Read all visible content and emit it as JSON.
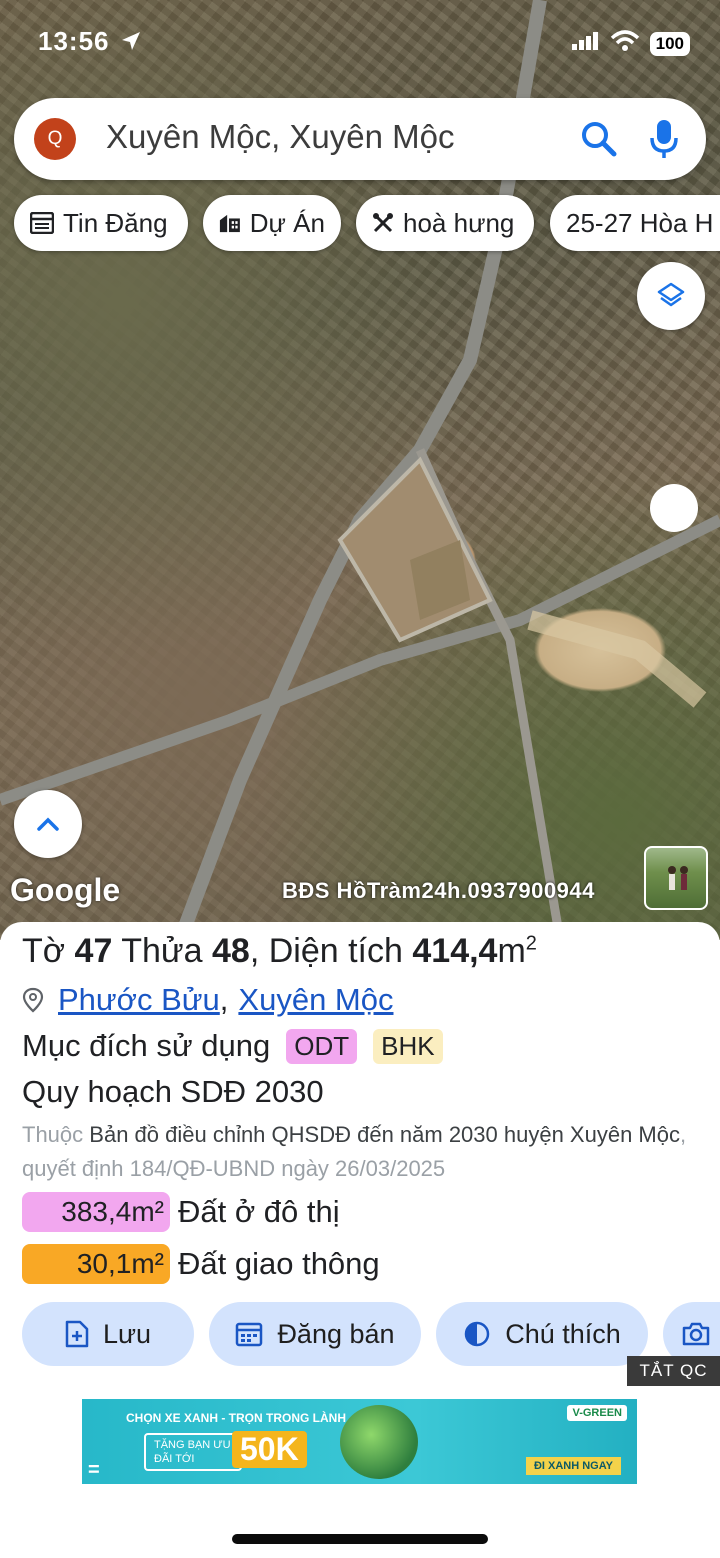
{
  "status": {
    "time": "13:56",
    "battery": "100"
  },
  "search": {
    "logo": "Q",
    "query": "Xuyên Mộc, Xuyên Mộc"
  },
  "chips": [
    {
      "label": "Tin Đăng",
      "icon": "listing-icon"
    },
    {
      "label": "Dự Án",
      "icon": "building-icon"
    },
    {
      "label": "hoà hưng",
      "icon": "crossed-tools-icon"
    },
    {
      "label": "25-27 Hòa H",
      "icon": ""
    }
  ],
  "map": {
    "logo": "Google",
    "watermark": "BĐS HồTràm24h.0937900944"
  },
  "parcel": {
    "to_label": "Tờ",
    "to_value": "47",
    "thua_label": "Thửa",
    "thua_value": "48",
    "area_label": ", Diện tích",
    "area_value": "414,4",
    "area_unit": "m",
    "area_sup": "2",
    "ward": "Phước Bửu",
    "comma": ",",
    "district": "Xuyên Mộc",
    "purpose_label": "Mục đích sử dụng",
    "badges": [
      "ODT",
      "BHK"
    ],
    "plan_title": "Quy hoạch SDĐ 2030",
    "desc_prefix": "Thuộc",
    "desc_main": "Bản đồ điều chỉnh QHSDĐ đến năm 2030 huyện Xuyên Mộc",
    "desc_suffix": ", quyết định 184/QĐ-UBND ngày 26/03/2025",
    "areas": [
      {
        "value": "383,4m²",
        "label": "Đất ở đô thị",
        "color": "#f2a7ef"
      },
      {
        "value": "30,1m²",
        "label": "Đất giao thông",
        "color": "#f9a825"
      }
    ]
  },
  "actions": [
    {
      "label": "Lưu",
      "icon": "save-icon"
    },
    {
      "label": "Đăng bán",
      "icon": "calendar-icon"
    },
    {
      "label": "Chú thích",
      "icon": "contrast-icon"
    },
    {
      "label": "",
      "icon": "camera-icon"
    }
  ],
  "ad": {
    "close_label": "TẮT QC",
    "headline": "CHỌN XE XANH - TRỌN TRONG LÀNH",
    "offer_text": "TẶNG BẠN ƯU ĐÃI TỚI",
    "offer_value": "50K",
    "brand": "V-GREEN",
    "cta": "ĐI XANH NGAY",
    "eq": "="
  }
}
